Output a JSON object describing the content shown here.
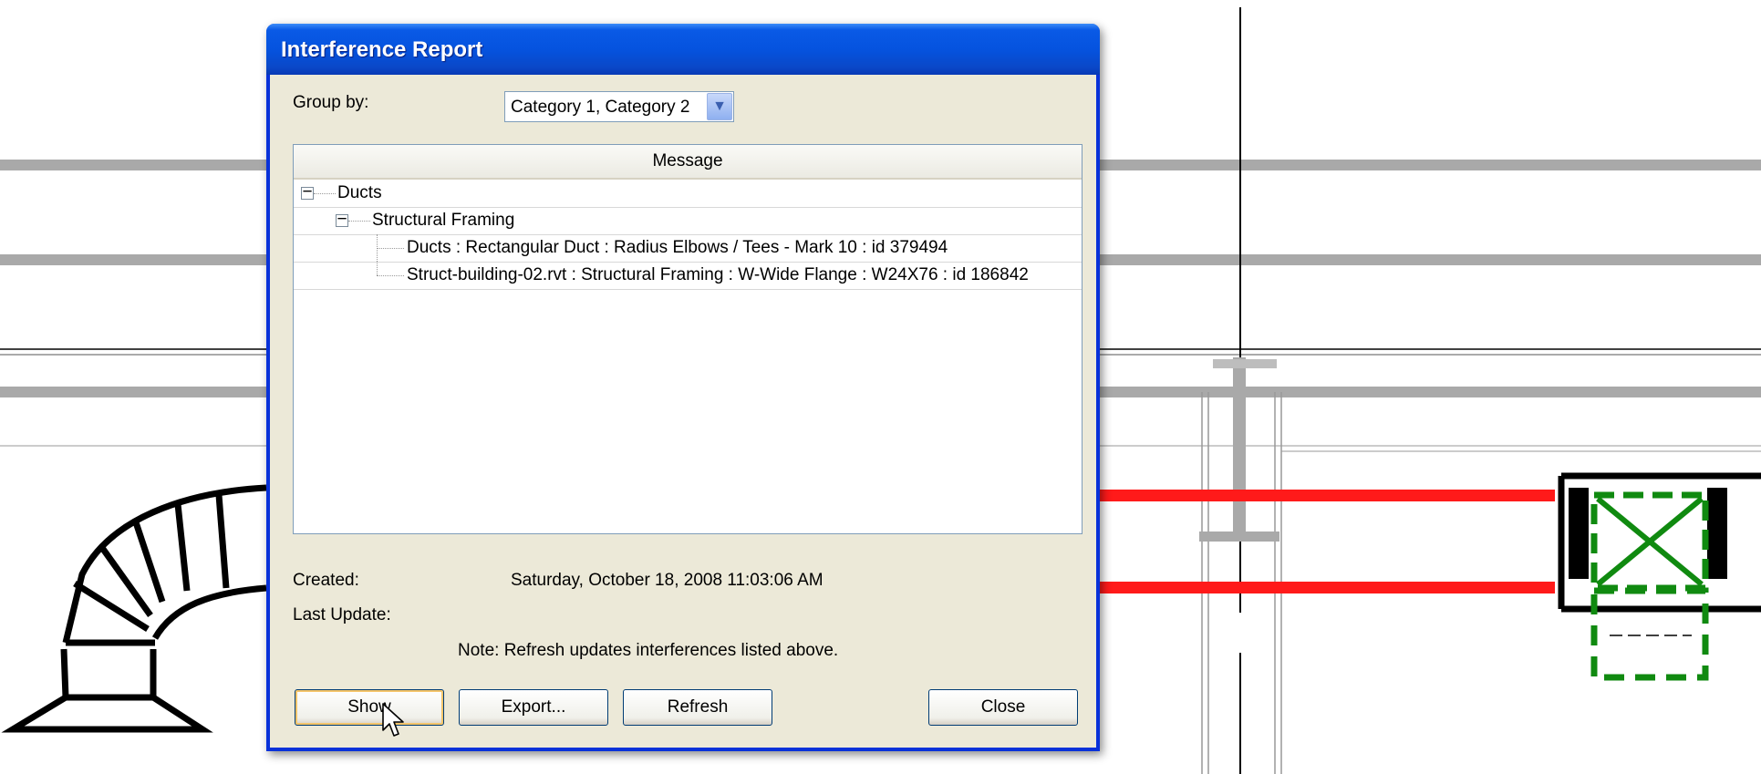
{
  "dialog": {
    "title": "Interference Report",
    "group_by_label": "Group by:",
    "group_by_value": "Category 1, Category 2",
    "column_header": "Message",
    "tree": [
      {
        "label": "Ducts",
        "level": 0,
        "expanded": true
      },
      {
        "label": "Structural Framing",
        "level": 1,
        "expanded": true
      },
      {
        "label": "Ducts : Rectangular Duct : Radius Elbows / Tees - Mark 10 : id 379494",
        "level": 2
      },
      {
        "label": "Struct-building-02.rvt : Structural Framing : W-Wide Flange : W24X76 : id 186842",
        "level": 2
      }
    ],
    "created_label": "Created:",
    "created_value": "Saturday, October 18, 2008 11:03:06 AM",
    "last_update_label": "Last Update:",
    "last_update_value": "",
    "note": "Note: Refresh updates interferences listed above.",
    "buttons": {
      "show": "Show",
      "export": "Export...",
      "refresh": "Refresh",
      "close": "Close"
    }
  },
  "colors": {
    "titlebar": "#0553df",
    "dialog_bg": "#ece9d8",
    "duct_red": "#ff1a1a",
    "selection_green": "#108a10"
  }
}
